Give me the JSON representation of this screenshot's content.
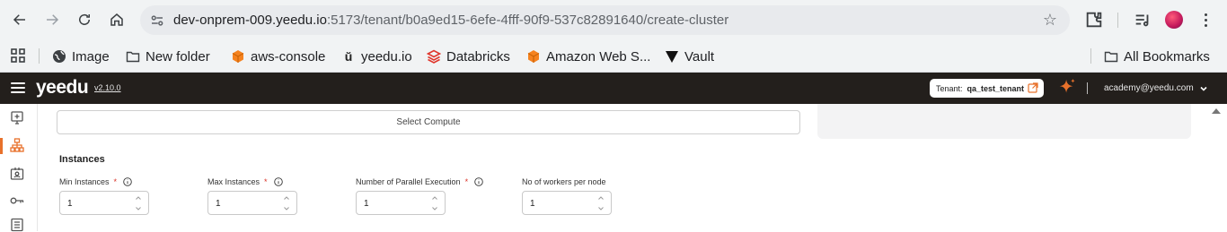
{
  "browser": {
    "url_host": "dev-onprem-009.yeedu.io",
    "url_path": ":5173/tenant/b0a9ed15-6efe-4fff-90f9-537c82891640/create-cluster"
  },
  "bookmarks": {
    "items": [
      {
        "label": "Image",
        "icon": "globe-icon"
      },
      {
        "label": "New folder",
        "icon": "folder-icon"
      },
      {
        "label": "aws-console",
        "icon": "aws-cube-icon"
      },
      {
        "label": "yeedu.io",
        "icon": "yeedu-icon"
      },
      {
        "label": "Databricks",
        "icon": "databricks-icon"
      },
      {
        "label": "Amazon Web S...",
        "icon": "aws-cube-icon"
      },
      {
        "label": "Vault",
        "icon": "vault-icon"
      }
    ],
    "all_bookmarks": "All Bookmarks"
  },
  "app": {
    "logo": "yeedu",
    "version": "v2.10.0",
    "tenant_label": "Tenant:",
    "tenant_value": "qa_test_tenant",
    "user_email": "academy@yeedu.com",
    "accent_color": "#e8712b"
  },
  "form": {
    "select_compute_label": "Select Compute",
    "instances_section_title": "Instances",
    "fields": [
      {
        "label": "Min Instances",
        "required": true,
        "info": true,
        "value": "1"
      },
      {
        "label": "Max Instances",
        "required": true,
        "info": true,
        "value": "1"
      },
      {
        "label": "Number of Parallel Execution",
        "required": true,
        "info": true,
        "value": "1"
      },
      {
        "label": "No of workers per node",
        "required": false,
        "info": false,
        "value": "1"
      }
    ],
    "required_marker": "*"
  }
}
